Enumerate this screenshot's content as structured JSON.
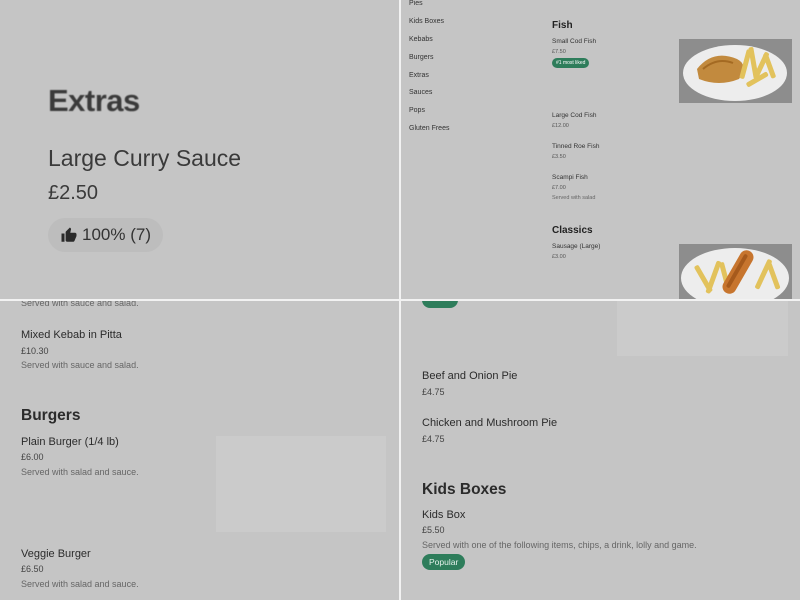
{
  "zoom_card": {
    "section_title": "Extras",
    "item_name": "Large Curry Sauce",
    "item_price": "£2.50",
    "rating": "100% (7)"
  },
  "nav": {
    "items": [
      "Pies",
      "Kids Boxes",
      "Kebabs",
      "Burgers",
      "Extras",
      "Sauces",
      "Pops",
      "Gluten Frees"
    ]
  },
  "menu_overview": {
    "fish": {
      "title": "Fish",
      "items": [
        {
          "name": "Small Cod Fish",
          "price": "£7.50",
          "badge": "#1 most liked"
        },
        {
          "name": "Large Cod Fish",
          "price": "£12.00"
        },
        {
          "name": "Tinned Roe Fish",
          "price": "£3.50"
        },
        {
          "name": "Scampi Fish",
          "price": "£7.00",
          "desc": "Served with salad"
        }
      ]
    },
    "classics": {
      "title": "Classics",
      "items": [
        {
          "name": "Sausage (Large)",
          "price": "£3.00"
        }
      ]
    }
  },
  "kebabs_burgers": {
    "partial_desc": "Served with sauce and salad.",
    "mixed_kebab": {
      "name": "Mixed Kebab in Pitta",
      "price": "£10.30",
      "desc": "Served with sauce and salad."
    },
    "burgers_title": "Burgers",
    "plain_burger": {
      "name": "Plain Burger (1/4 lb)",
      "price": "£6.00",
      "desc": "Served with salad and sauce."
    },
    "veggie_burger": {
      "name": "Veggie Burger",
      "price": "£6.50",
      "desc": "Served with salad and sauce."
    }
  },
  "pies_kids": {
    "beef_pie": {
      "name": "Beef and Onion Pie",
      "price": "£4.75"
    },
    "chicken_pie": {
      "name": "Chicken and Mushroom Pie",
      "price": "£4.75"
    },
    "kids_title": "Kids Boxes",
    "kids_box": {
      "name": "Kids Box",
      "price": "£5.50",
      "desc": "Served with one of the following items, chips, a drink, lolly and game.",
      "badge": "Popular"
    }
  },
  "colors": {
    "badge_green": "#2e7d5b",
    "overlay_grey": "#c5c5c5"
  }
}
